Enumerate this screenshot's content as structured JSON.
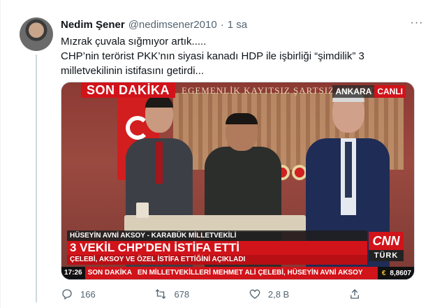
{
  "tweet": {
    "author_name": "Nedim Şener",
    "handle": "@nedimsener2010",
    "separator": "·",
    "time": "1 sa",
    "text_lines": [
      "Mızrak çuvala sığmıyor artık.....",
      "CHP’nin terörist PKK’nın siyasi kanadı HDP ile işbirliği “şimdilik” 3",
      "milletvekilinin istifasını getirdi..."
    ]
  },
  "media": {
    "top_banner": "SON DAKİKA",
    "wall_text": "EGEMENLİK KAYITSIZ ŞARTSIZ MİLLETİNDİR",
    "live_city": "ANKARA",
    "live_label": "CANLI",
    "speaker": "HÜSEYİN AVNİ AKSOY - KARABÜK MİLLETVEKİLİ",
    "headline": "3 VEKİL CHP'DEN İSTİFA ETTİ",
    "subline": "ÇELEBİ, AKSOY VE ÖZEL İSTİFA ETTİĞİNİ AÇIKLADI",
    "channel_logo": "CNN",
    "channel_sub": "TÜRK",
    "ticker_time": "17:26",
    "ticker_label": "SON DAKİKA",
    "ticker_text": "EN MİLLETVEKİLLERİ MEHMET ALİ ÇELEBİ, HÜSEYİN AVNİ AKSOY",
    "fx_symbol": "€",
    "fx_value": "8,8607"
  },
  "actions": {
    "reply_count": "166",
    "retweet_count": "678",
    "like_count": "2,8 B",
    "share_label": ""
  },
  "colors": {
    "accent_red": "#d1131a",
    "text_primary": "#0f1419",
    "text_secondary": "#536471"
  }
}
